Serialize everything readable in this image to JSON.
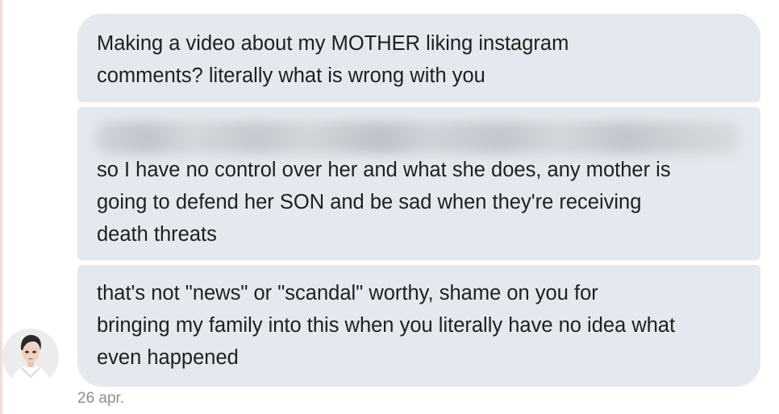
{
  "messages": [
    {
      "lines": [
        "Making a video about my MOTHER liking instagram",
        "comments? literally what is wrong with you"
      ]
    },
    {
      "redacted": true,
      "lines": [
        "so I have no control over her and what she does, any mother is",
        "going to defend her SON and be sad when they're receiving",
        "death threats"
      ]
    },
    {
      "lines": [
        "that's not \"news\" or \"scandal\" worthy, shame on you for",
        "bringing my family into this when you literally have no idea what",
        "even happened"
      ]
    }
  ],
  "timestamp": "26 apr.",
  "colors": {
    "bubble": "#e3e9ee",
    "text": "#1f1f1f",
    "timestamp": "#8a8f94"
  },
  "icons": {
    "avatar": "user-avatar-icon"
  }
}
